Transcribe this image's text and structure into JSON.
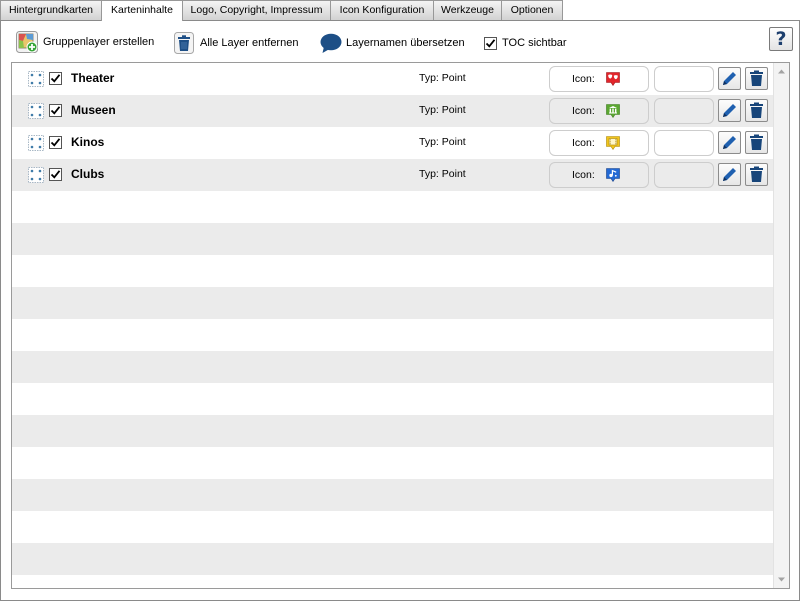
{
  "tabs": [
    {
      "label": "Hintergrundkarten",
      "active": false
    },
    {
      "label": "Karteninhalte",
      "active": true
    },
    {
      "label": "Logo, Copyright, Impressum",
      "active": false
    },
    {
      "label": "Icon Konfiguration",
      "active": false
    },
    {
      "label": "Werkzeuge",
      "active": false
    },
    {
      "label": "Optionen",
      "active": false
    }
  ],
  "toolbar": {
    "create_group": {
      "label": "Gruppenlayer erstellen",
      "icon": "add-group-layer-icon"
    },
    "remove_all": {
      "label": "Alle Layer entfernen",
      "icon": "trash-icon"
    },
    "translate": {
      "label": "Layernamen übersetzen",
      "icon": "speech-bubble-icon"
    },
    "toc": {
      "label": "TOC sichtbar",
      "checked": true
    },
    "help": {
      "label": "?",
      "icon": "help-icon"
    }
  },
  "labels": {
    "type_prefix": "Typ:",
    "icon_prefix": "Icon:"
  },
  "layers": [
    {
      "name": "Theater",
      "type": "Point",
      "visible": true,
      "icon": "theater-masks-marker-icon",
      "icon_color": "#e2252b"
    },
    {
      "name": "Museen",
      "type": "Point",
      "visible": true,
      "icon": "museum-marker-icon",
      "icon_color": "#5ba731"
    },
    {
      "name": "Kinos",
      "type": "Point",
      "visible": true,
      "icon": "cinema-marker-icon",
      "icon_color": "#f2c51c"
    },
    {
      "name": "Clubs",
      "type": "Point",
      "visible": true,
      "icon": "club-marker-icon",
      "icon_color": "#2369d4"
    }
  ],
  "colors": {
    "row_stripe": "#ebebeb",
    "icon_navy": "#1e4f86",
    "pencil_blue": "#1f60b0"
  }
}
